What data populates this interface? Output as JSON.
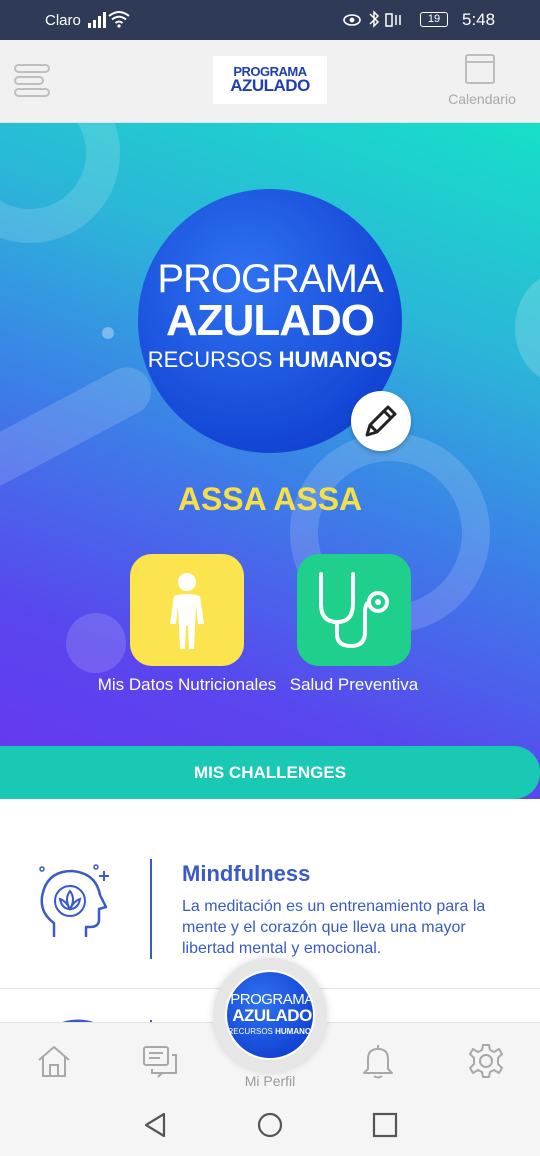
{
  "status_bar": {
    "carrier": "Claro",
    "battery": "19",
    "time": "5:48"
  },
  "header": {
    "logo_line1": "PROGRAMA",
    "logo_line2": "AZULADO",
    "calendar_label": "Calendario"
  },
  "profile": {
    "avatar_line1": "PROGRAMA",
    "avatar_line2": "AZULADO",
    "avatar_line3_light": "RECURSOS",
    "avatar_line3_bold": "HUMANOS",
    "user_name": "ASSA ASSA"
  },
  "tiles": [
    {
      "label": "Mis Datos Nutricionales",
      "icon": "person-icon",
      "color": "#fbe44e"
    },
    {
      "label": "Salud Preventiva",
      "icon": "stethoscope-icon",
      "color": "#1fcf8c"
    }
  ],
  "challenges": {
    "bar_label": "MIS CHALLENGES",
    "items": [
      {
        "title": "Mindfulness",
        "description": "La meditación es un entrenamiento para la mente y el corazón que lleva una mayor libertad mental y emocional.",
        "icon": "meditation-head-icon"
      }
    ]
  },
  "bottom_nav": {
    "items": [
      {
        "icon": "home-icon"
      },
      {
        "icon": "chat-icon"
      },
      {
        "icon": "bell-icon"
      },
      {
        "icon": "gear-icon"
      }
    ],
    "profile_label": "Mi Perfil"
  },
  "colors": {
    "accent_blue": "#3a5bc7",
    "teal": "#19c9b4",
    "yellow": "#f6e04a",
    "status_bar": "#2f3a57"
  }
}
